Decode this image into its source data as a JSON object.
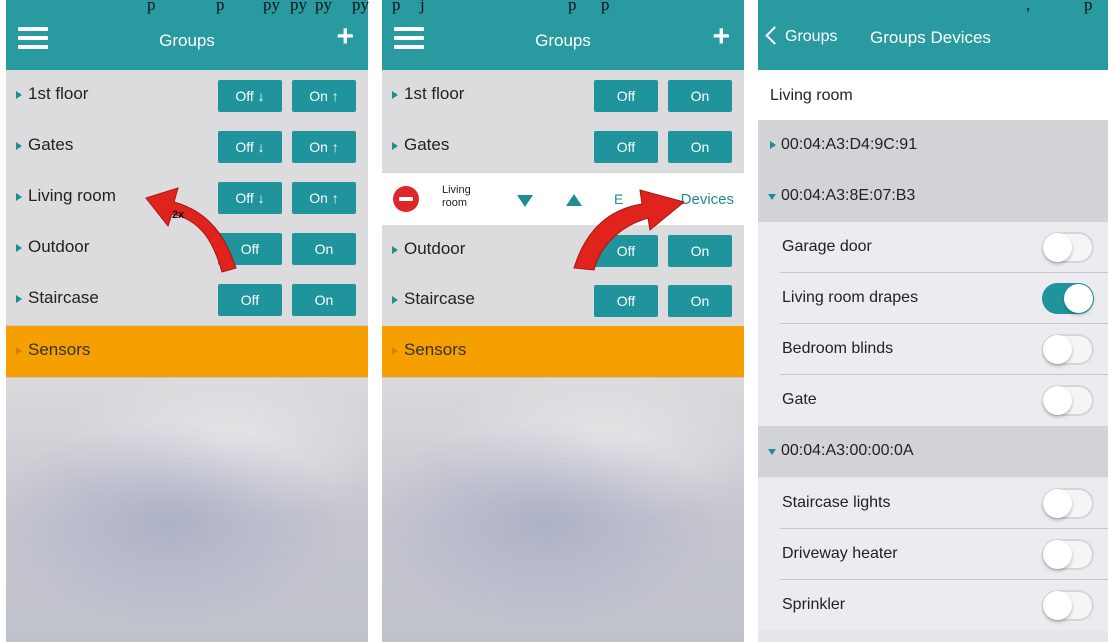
{
  "caption_fragments": [
    "p",
    "p",
    "py",
    "py",
    "py",
    "py",
    "p",
    "j",
    "p",
    "p",
    ",",
    "p"
  ],
  "panel1": {
    "header_title": "Groups",
    "rows": [
      {
        "label": "1st floor",
        "off": "Off ↓",
        "on": "On ↑"
      },
      {
        "label": "Gates",
        "off": "Off ↓",
        "on": "On ↑"
      },
      {
        "label": "Living room",
        "off": "Off ↓",
        "on": "On ↑"
      },
      {
        "label": "Outdoor",
        "off": "Off",
        "on": "On"
      },
      {
        "label": "Staircase",
        "off": "Off",
        "on": "On"
      }
    ],
    "sensors": "Sensors",
    "annotation": "2x"
  },
  "panel2": {
    "header_title": "Groups",
    "rows": [
      {
        "label": "1st floor",
        "off": "Off",
        "on": "On"
      },
      {
        "label": "Gates",
        "off": "Off",
        "on": "On"
      },
      {
        "label": "Outdoor",
        "off": "Off",
        "on": "On"
      },
      {
        "label": "Staircase",
        "off": "Off",
        "on": "On"
      }
    ],
    "edit_row": {
      "name": "Living room",
      "edit": "E",
      "devices": "Devices"
    },
    "sensors": "Sensors"
  },
  "panel3": {
    "back_label": "Groups",
    "title": "Groups Devices",
    "group_name": "Living room",
    "macs": [
      "00:04:A3:D4:9C:91",
      "00:04:A3:8E:07:B3",
      "00:04:A3:00:00:0A"
    ],
    "devices_b3": [
      {
        "label": "Garage door",
        "on": false
      },
      {
        "label": "Living room drapes",
        "on": true
      },
      {
        "label": "Bedroom blinds",
        "on": false
      },
      {
        "label": "Gate",
        "on": false
      }
    ],
    "devices_0a": [
      {
        "label": "Staircase lights",
        "on": false
      },
      {
        "label": "Driveway heater",
        "on": false
      },
      {
        "label": "Sprinkler",
        "on": false
      }
    ]
  },
  "colors": {
    "teal": "#2a9aa1",
    "button": "#1f949d",
    "sensors": "#f5a000",
    "delete": "#e0262b",
    "arrow": "#e0241d"
  }
}
